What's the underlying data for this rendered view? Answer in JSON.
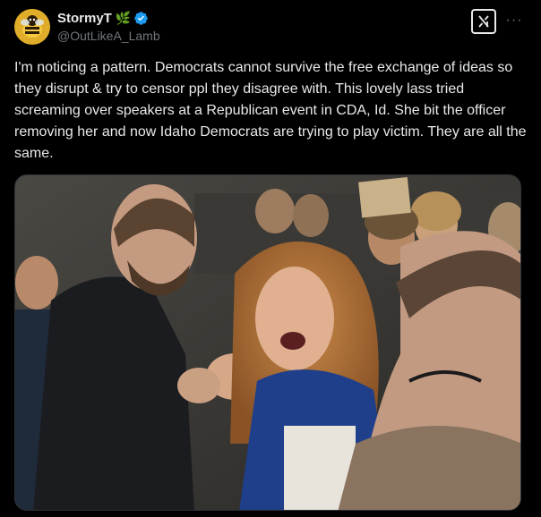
{
  "author": {
    "display_name": "StormyT",
    "name_emoji": "🌿",
    "handle": "@OutLikeA_Lamb",
    "verified": true,
    "avatar_icon": "bee-avatar-icon"
  },
  "actions": {
    "grok_icon": "grok-icon",
    "more_icon": "more-options-icon",
    "more_label": "···"
  },
  "tweet": {
    "text": "I'm noticing a pattern. Democrats cannot survive the free exchange of ideas so they disrupt & try to censor ppl they disagree with. This lovely lass tried screaming over speakers at a Republican event in CDA, Id. She bit the officer removing her and now Idaho Democrats are trying to play victim. They are all the same."
  },
  "colors": {
    "background": "#000000",
    "text": "#e7e9ea",
    "secondary_text": "#71767b",
    "verified_blue": "#1d9bf0",
    "border": "#2f3336"
  }
}
